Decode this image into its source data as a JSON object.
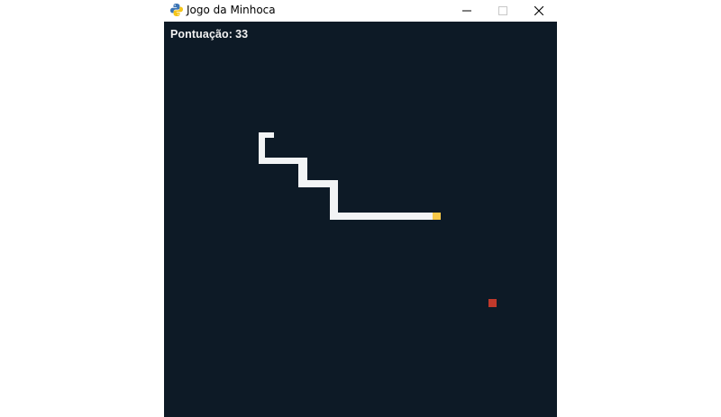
{
  "window": {
    "title": "Jogo da Minhoca",
    "app_icon": "python-icon"
  },
  "controls": {
    "minimize": "minimize-icon",
    "maximize": "maximize-icon",
    "close": "close-icon"
  },
  "score": {
    "label": "Pontuação:",
    "value": "33"
  },
  "colors": {
    "background": "#0d1a26",
    "snake_body": "#f2f4f5",
    "snake_head": "#f7c948",
    "food": "#c0392b",
    "score_text": "#f2f2f2"
  }
}
